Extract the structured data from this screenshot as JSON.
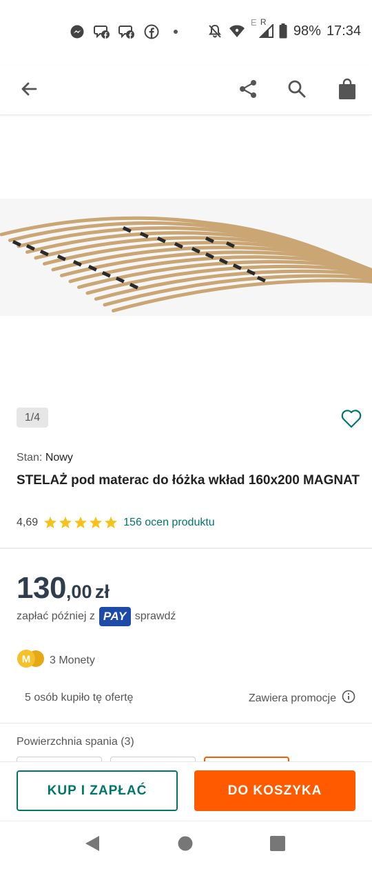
{
  "status_bar": {
    "battery": "98%",
    "time": "17:34",
    "network_letter_e": "E",
    "network_letter_r": "R"
  },
  "app_bar": {
    "back_icon": "arrow-left-icon",
    "share_icon": "share-icon",
    "search_icon": "search-icon",
    "cart_icon": "shopping-bag-icon"
  },
  "gallery": {
    "counter": "1/4"
  },
  "product": {
    "condition_label": "Stan:",
    "condition_value": "Nowy",
    "title": "STELAŻ pod materac do łóżka wkład 160x200 MAGNAT",
    "rating_score": "4,69",
    "rating_stars": 5,
    "rating_count": "156 ocen produktu"
  },
  "price": {
    "integer": "130",
    "decimal": ",00",
    "currency": "zł"
  },
  "pay_later": {
    "text": "zapłać później z",
    "badge": "PAY",
    "link": "sprawdź"
  },
  "coins": {
    "icon_letter": "M",
    "text": "3 Monety"
  },
  "offer_info": {
    "bought_text": "5 osób kupiło tę ofertę",
    "promo_text": "Zawiera promocje"
  },
  "specs": {
    "label": "Powierzchnia spania (3)"
  },
  "actions": {
    "buy_label": "KUP I ZAPŁAĆ",
    "cart_label": "DO KOSZYKA"
  },
  "colors": {
    "accent_teal": "#00756a",
    "accent_orange": "#ff5a00",
    "price_dark": "#2f3d4c",
    "star_yellow": "#f7c21a",
    "pay_blue": "#1e4aa8"
  }
}
